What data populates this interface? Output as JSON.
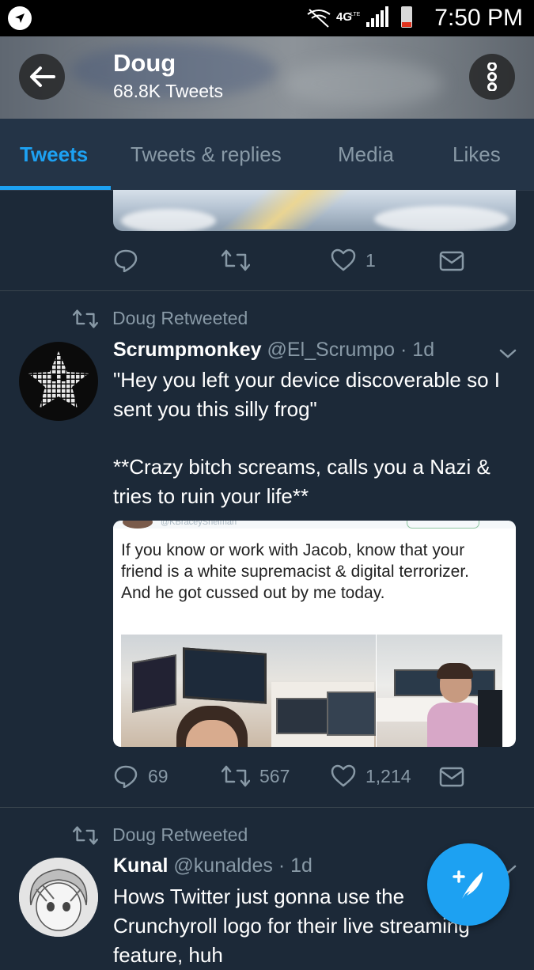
{
  "status_bar": {
    "time": "7:50 PM",
    "network": "4G"
  },
  "header": {
    "name": "Doug",
    "tweet_count": "68.8K Tweets"
  },
  "tabs": [
    {
      "label": "Tweets",
      "active": true
    },
    {
      "label": "Tweets & replies",
      "active": false
    },
    {
      "label": "Media",
      "active": false
    },
    {
      "label": "Likes",
      "active": false
    }
  ],
  "tweet_fragment": {
    "likes": "1"
  },
  "tweet1": {
    "retweet_label": "Doug Retweeted",
    "display_name": "Scrumpmonkey",
    "handle": "@El_Scrumpo",
    "time": "· 1d",
    "text_line1": "\"Hey you left your device discoverable so I sent you this silly frog\"",
    "text_line2": "**Crazy bitch screams, calls you a Nazi & tries to ruin your life**",
    "embed": {
      "handle": "@KBraceyShelman",
      "text": "If you know or work with Jacob, know that your friend is a white supremacist & digital terrorizer. And he got cussed out by me today."
    },
    "replies": "69",
    "retweets": "567",
    "likes": "1,214"
  },
  "tweet2": {
    "retweet_label": "Doug Retweeted",
    "display_name": "Kunal",
    "handle": "@kunaldes",
    "time": "· 1d",
    "text": "Hows Twitter just gonna use the Crunchyroll logo for their live streaming feature, huh"
  },
  "colors": {
    "accent": "#1da1f2",
    "background": "#1c2938",
    "secondary_text": "#8899a6"
  },
  "icons": [
    "back-arrow-icon",
    "overflow-menu-icon",
    "reply-icon",
    "retweet-icon",
    "heart-icon",
    "direct-message-icon",
    "chevron-down-icon",
    "compose-tweet-icon"
  ]
}
